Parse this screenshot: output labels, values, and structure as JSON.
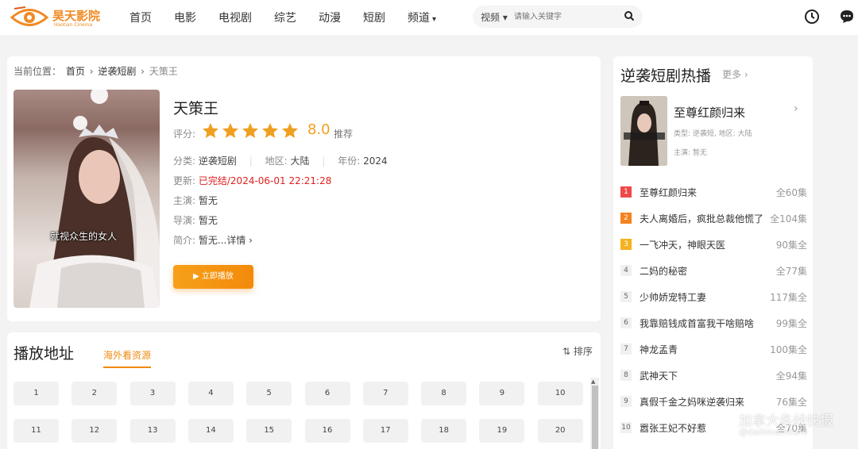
{
  "header": {
    "logo_text": "昊天影院",
    "logo_sub": "Haotian Cinema",
    "nav": [
      "首页",
      "电影",
      "电视剧",
      "综艺",
      "动漫",
      "短剧",
      "频道"
    ],
    "search_type": "视频",
    "search_placeholder": "请输入关键字"
  },
  "breadcrumb": {
    "label": "当前位置：",
    "items": [
      "首页",
      "逆袭短剧",
      "天策王"
    ]
  },
  "detail": {
    "poster_subtitle": "就视众生的女人",
    "title": "天策王",
    "rating_label": "评分:",
    "rating_stars": 5,
    "score": "8.0",
    "score_tag": "推荐",
    "category_label": "分类:",
    "category": "逆袭短剧",
    "region_label": "地区:",
    "region": "大陆",
    "year_label": "年份:",
    "year": "2024",
    "update_label": "更新:",
    "update": "已完结/2024-06-01 22:21:28",
    "actors_label": "主演:",
    "actors": "暂无",
    "director_label": "导演:",
    "director": "暂无",
    "intro_label": "简介:",
    "intro": "暂无...详情",
    "play_button": "立即播放"
  },
  "playlist": {
    "title": "播放地址",
    "source_tab": "海外看资源",
    "sort_label": "排序",
    "episodes": [
      "1",
      "2",
      "3",
      "4",
      "5",
      "6",
      "7",
      "8",
      "9",
      "10",
      "11",
      "12",
      "13",
      "14",
      "15",
      "16",
      "17",
      "18",
      "19",
      "20"
    ]
  },
  "sidebar": {
    "title": "逆袭短剧热播",
    "more": "更多",
    "featured": {
      "title": "至尊红颜归来",
      "type_label": "类型:",
      "type": "逆袭短",
      "region_label": "地区:",
      "region": "大陆",
      "actors_label": "主演:",
      "actors": "暂无"
    },
    "ranking": [
      {
        "num": "1",
        "name": "至尊红颜归来",
        "status": "全60集"
      },
      {
        "num": "2",
        "name": "夫人离婚后，疯批总裁他慌了",
        "status": "全104集"
      },
      {
        "num": "3",
        "name": "一飞冲天，神眼天医",
        "status": "90集全"
      },
      {
        "num": "4",
        "name": "二妈的秘密",
        "status": "全77集"
      },
      {
        "num": "5",
        "name": "少帅娇宠特工妻",
        "status": "117集全"
      },
      {
        "num": "6",
        "name": "我靠赔钱成首富我干啥赔啥",
        "status": "99集全"
      },
      {
        "num": "7",
        "name": "神龙孟青",
        "status": "100集全"
      },
      {
        "num": "8",
        "name": "武神天下",
        "status": "全94集"
      },
      {
        "num": "9",
        "name": "真假千金之妈咪逆袭归来",
        "status": "76集全"
      },
      {
        "num": "10",
        "name": "嚣张王妃不好惹",
        "status": "全70集"
      }
    ]
  },
  "colors": {
    "accent": "#f08a10",
    "rank1": "#f04848",
    "rank2": "#f5821f",
    "rank3": "#f5b21f",
    "star": "#f0a020",
    "update": "#e02020"
  },
  "watermark": {
    "text": "加拿大各线快报",
    "sub": "@dailimathkafe"
  }
}
